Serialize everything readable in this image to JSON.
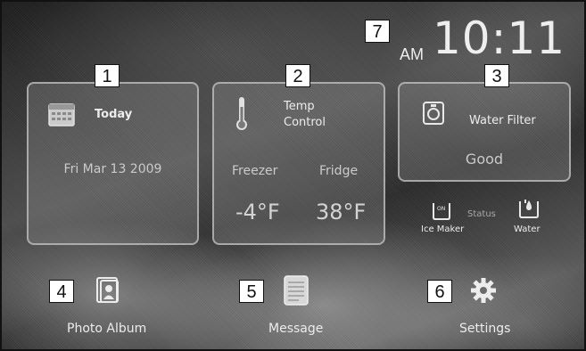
{
  "clock": {
    "ampm": "AM",
    "time": "10:11"
  },
  "callouts": [
    "1",
    "2",
    "3",
    "4",
    "5",
    "6",
    "7"
  ],
  "today": {
    "label": "Today",
    "date": "Fri Mar 13 2009"
  },
  "temp": {
    "title_line1": "Temp",
    "title_line2": "Control",
    "freezer_label": "Freezer",
    "fridge_label": "Fridge",
    "freezer_value": "-4°F",
    "fridge_value": "38°F"
  },
  "water_filter": {
    "label": "Water Filter",
    "status": "Good"
  },
  "status_row": {
    "ice_label": "Ice Maker",
    "ice_badge": "ON",
    "status_label": "Status",
    "water_label": "Water"
  },
  "bottom": {
    "photo_label": "Photo Album",
    "message_label": "Message",
    "settings_label": "Settings"
  },
  "icons": [
    "calendar-icon",
    "thermometer-icon",
    "filter-icon",
    "ice-maker-icon",
    "water-icon",
    "photo-album-icon",
    "message-icon",
    "gear-icon"
  ]
}
